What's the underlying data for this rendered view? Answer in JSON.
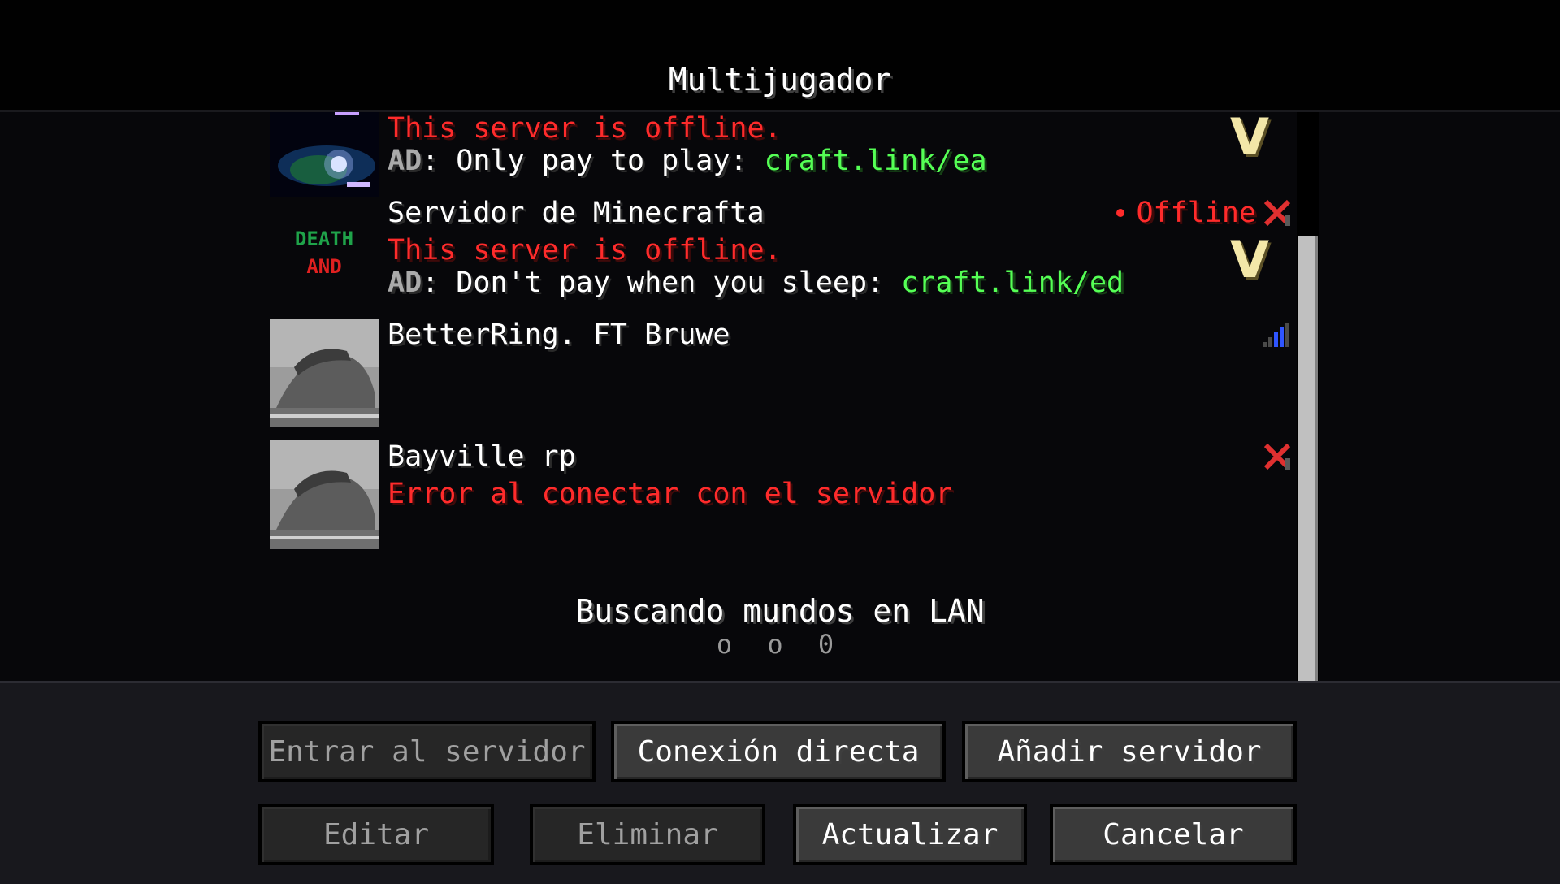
{
  "header": {
    "title": "Multijugador"
  },
  "servers": [
    {
      "name": "",
      "motd": "This server is offline.",
      "ad_prefix": "AD",
      "ad_text": ": Only pay to play: ",
      "ad_link": "craft.link/ea",
      "status_text": "",
      "status_icon": "v-icon"
    },
    {
      "name": "Servidor de Minecrafta",
      "motd": "This server is offline.",
      "ad_prefix": "AD",
      "ad_text": ": Don't pay when you sleep: ",
      "ad_link": "craft.link/ed",
      "status_text": "Offline",
      "status_icon": "x-icon",
      "thumb_text": [
        "DEATH",
        "AND"
      ]
    },
    {
      "name": "BetterRing. FT Bruwe",
      "status_icon": "signal-bars-icon"
    },
    {
      "name": "Bayville rp",
      "error": "Error al conectar con el servidor",
      "status_icon": "x-icon"
    }
  ],
  "lan": {
    "title": "Buscando mundos en LAN",
    "dots": "o o 0"
  },
  "buttons": {
    "join": "Entrar al servidor",
    "direct": "Conexión directa",
    "add": "Añadir servidor",
    "edit": "Editar",
    "delete": "Eliminar",
    "refresh": "Actualizar",
    "cancel": "Cancelar"
  },
  "colors": {
    "offline_red": "#ff2b2b",
    "link_green": "#55ff55",
    "v_gold": "#f3e7a8",
    "signal_blue": "#2f55ff"
  }
}
